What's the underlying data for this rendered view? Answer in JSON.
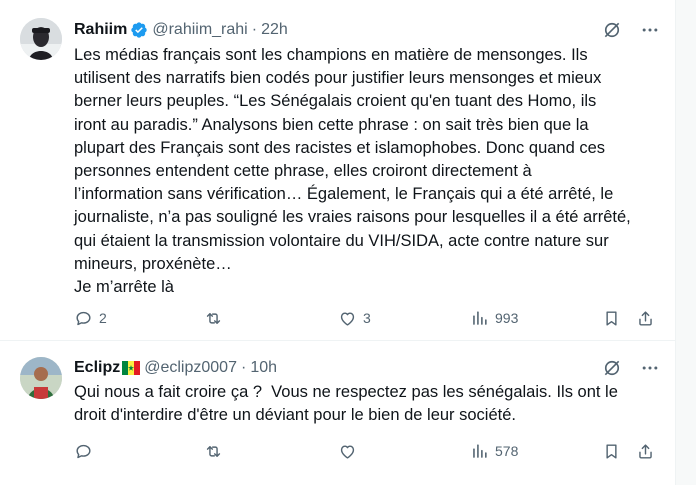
{
  "tweets": [
    {
      "author_name": "Rahiim",
      "handle": "@rahiim_rahi",
      "separator": "·",
      "time": "22h",
      "verified": true,
      "avatar_icon": "user-avatar-photo",
      "body": "Les médias français sont les champions en matière de mensonges. Ils\nutilisent des narratifs bien codés pour justifier leurs mensonges et mieux\nberner leurs peuples. “Les Sénégalais croient qu'en tuant des Homo, ils\niront au paradis.” Analysons bien cette phrase : on sait très bien que la\nplupart des Français sont des racistes et islamophobes. Donc quand ces\npersonnes entendent cette phrase, elles croiront directement à\nl’information sans vérification… Également, le Français qui a été arrêté, le\njournaliste, n’a pas souligné les vraies raisons pour lesquelles il a été arrêté,\nqui étaient la transmission volontaire du VIH/SIDA, acte contre nature sur\nmineurs, proxénète…\nJe m’arrête là",
      "replies": "2",
      "retweets": "",
      "likes": "3",
      "views": "993"
    },
    {
      "author_name": "Eclipz",
      "handle": "@eclipz0007",
      "separator": "·",
      "time": "10h",
      "verified": false,
      "flag": "senegal-flag",
      "avatar_icon": "user-avatar-photo",
      "body": "Qui nous a fait croire ça ?  Vous ne respectez pas les sénégalais. Ils ont le\ndroit d'interdire d'être un déviant pour le bien de leur société.",
      "replies": "",
      "retweets": "",
      "likes": "",
      "views": "578"
    }
  ],
  "colors": {
    "text": "#0f1419",
    "secondary": "#536471",
    "verified_blue": "#1d9bf0",
    "divider": "#eff3f4"
  }
}
